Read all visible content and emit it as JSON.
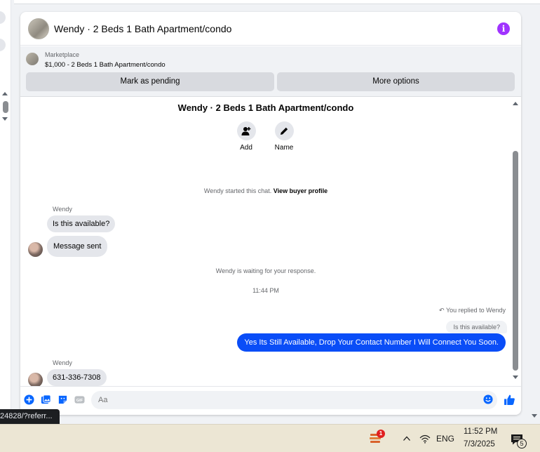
{
  "header": {
    "title": "Wendy · 2 Beds 1 Bath Apartment/condo",
    "info_icon_glyph": "i"
  },
  "marketplace": {
    "label": "Marketplace",
    "item": "$1,000 - 2 Beds 1 Bath Apartment/condo",
    "buttons": {
      "mark_pending": "Mark as pending",
      "more_options": "More options"
    }
  },
  "conversation": {
    "title": "Wendy · 2 Beds 1 Bath Apartment/condo",
    "actions": [
      {
        "label": "Add",
        "icon": "add-person-icon"
      },
      {
        "label": "Name",
        "icon": "pencil-icon"
      }
    ],
    "started_text": "Wendy started this chat.",
    "started_link": "View buyer profile",
    "messages": [
      {
        "sender": "Wendy",
        "text": "Is this available?"
      },
      {
        "text": "Message sent"
      }
    ],
    "waiting_text": "Wendy is waiting for your response.",
    "timestamp": "11:44 PM",
    "reply_note": "You replied to Wendy",
    "quoted_text": "Is this available?",
    "outgoing_text": "Yes Its Still Available, Drop Your Contact Number I Will Connect You Soon.",
    "last_sender": "Wendy",
    "last_message": "631-336-7308"
  },
  "composer": {
    "placeholder": "Aa"
  },
  "status_bar": {
    "url": "24828/?referr..."
  },
  "taskbar": {
    "app_badge": "1",
    "language": "ENG",
    "time": "11:52 PM",
    "date": "7/3/2025",
    "notification_count": "5"
  },
  "colors": {
    "accent_blue": "#0a4df7",
    "messenger_blue": "#0866ff",
    "info_purple": "#a033ff",
    "bubble_gray": "#e4e6eb"
  }
}
